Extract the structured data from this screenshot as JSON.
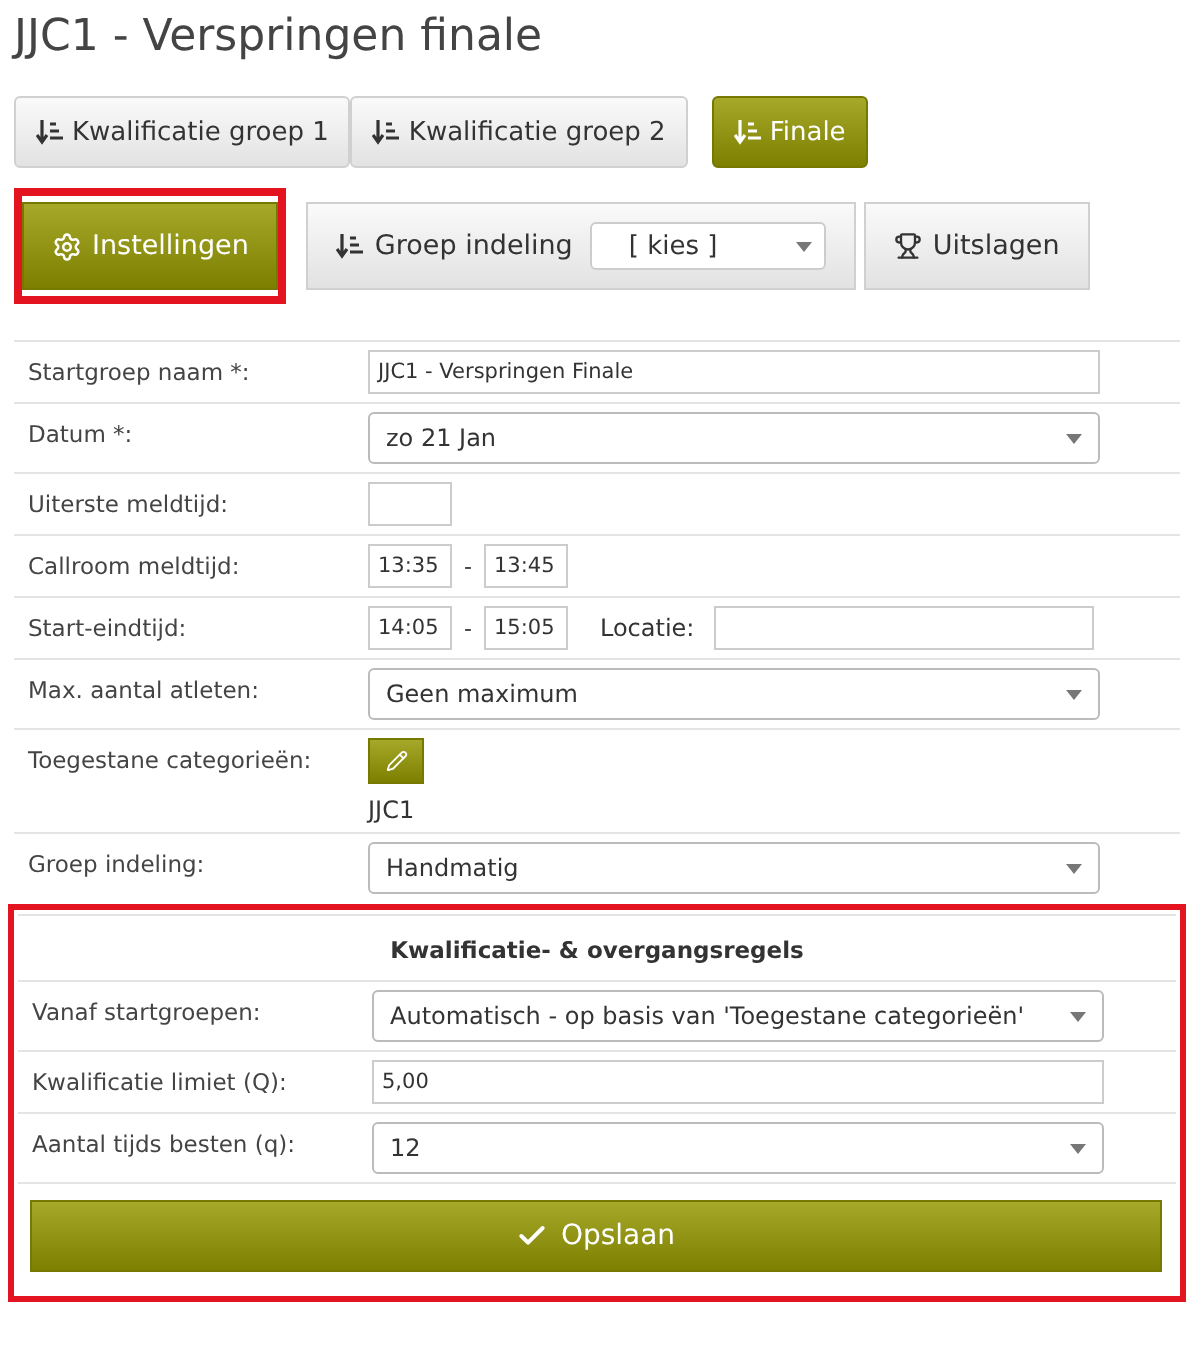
{
  "title": "JJC1 - Verspringen finale",
  "groups": [
    {
      "label": "Kwalificatie groep 1",
      "selected": false
    },
    {
      "label": "Kwalificatie groep 2",
      "selected": false
    },
    {
      "label": "Finale",
      "selected": true
    }
  ],
  "tabs": [
    {
      "kind": "gear",
      "label": "Instellingen",
      "selected": true,
      "highlighted": true
    },
    {
      "kind": "sort",
      "label": "Groep indeling",
      "selected": false,
      "highlighted": false,
      "select_value": "[ kies ]"
    },
    {
      "kind": "trophy",
      "label": "Uitslagen",
      "selected": false,
      "highlighted": false
    }
  ],
  "rows": [
    {
      "kind": "text",
      "label": "Startgroep naam *:",
      "value": "JJC1 - Verspringen Finale"
    },
    {
      "kind": "select",
      "label": "Datum *:",
      "value": "zo 21 Jan"
    },
    {
      "kind": "short",
      "label": "Uiterste meldtijd:"
    },
    {
      "kind": "range",
      "label": "Callroom meldtijd:",
      "from": "13:35",
      "separator": "-",
      "to": "13:45"
    },
    {
      "kind": "range",
      "label": "Start-eindtijd:",
      "from": "14:05",
      "separator": "-",
      "to": "15:05",
      "extra_label": "Locatie:"
    },
    {
      "kind": "select",
      "label": "Max. aantal atleten:",
      "value": "Geen maximum"
    },
    {
      "kind": "categories",
      "label": "Toegestane categorieën:",
      "items": [
        "JJC1"
      ]
    },
    {
      "kind": "select",
      "label": "Groep indeling:",
      "value": "Handmatig"
    }
  ],
  "rules": {
    "title": "Kwalificatie- & overgangsregels",
    "highlighted": true,
    "rows": [
      {
        "kind": "select",
        "label": "Vanaf startgroepen:",
        "value": "Automatisch - op basis van 'Toegestane categorieën'"
      },
      {
        "kind": "text",
        "label": "Kwalificatie limiet (Q):",
        "value": "5,00"
      },
      {
        "kind": "select",
        "label": "Aantal tijds besten (q):",
        "value": "12"
      }
    ],
    "save_button": "Opslaan"
  }
}
